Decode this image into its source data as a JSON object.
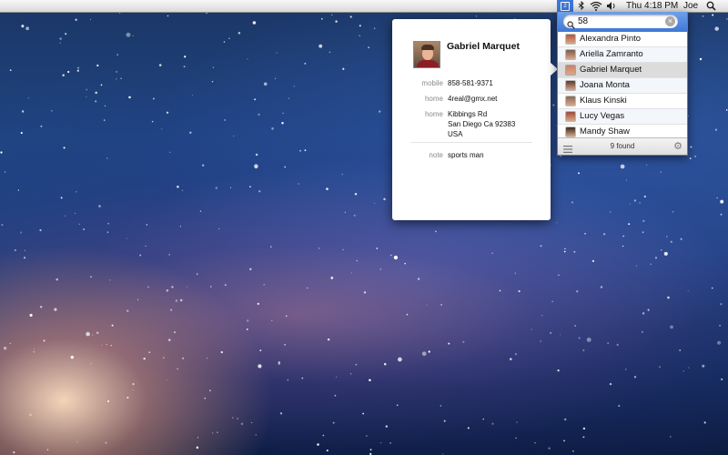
{
  "menubar": {
    "app_icon": "contacts-search-icon",
    "status_icons": [
      "bluetooth-icon",
      "wifi-icon",
      "volume-icon"
    ],
    "clock": "Thu 4:18 PM",
    "user": "Joe",
    "spotlight_icon": "spotlight-search-icon"
  },
  "search": {
    "query": "58",
    "placeholder": "",
    "results": [
      {
        "name": "Alexandra Pinto",
        "selected": false
      },
      {
        "name": "Ariella Zamranto",
        "selected": false
      },
      {
        "name": "Gabriel Marquet",
        "selected": true
      },
      {
        "name": "Joana Monta",
        "selected": false
      },
      {
        "name": "Klaus Kinski",
        "selected": false
      },
      {
        "name": "Lucy Vegas",
        "selected": false
      },
      {
        "name": "Mandy Shaw",
        "selected": false
      }
    ],
    "found_label": "9 found"
  },
  "card": {
    "name": "Gabriel Marquet",
    "fields": {
      "mobile": {
        "label": "mobile",
        "value": "858-581-9371"
      },
      "email": {
        "label": "home",
        "value": "4real@gmx.net"
      },
      "address": {
        "label": "home",
        "line1": "Kibbings Rd",
        "line2": "San Diego Ca 92383",
        "line3": "USA"
      },
      "note": {
        "label": "note",
        "value": "sports man"
      }
    }
  },
  "colors": {
    "accent": "#3f78d6",
    "selection": "#dcdcdc"
  }
}
